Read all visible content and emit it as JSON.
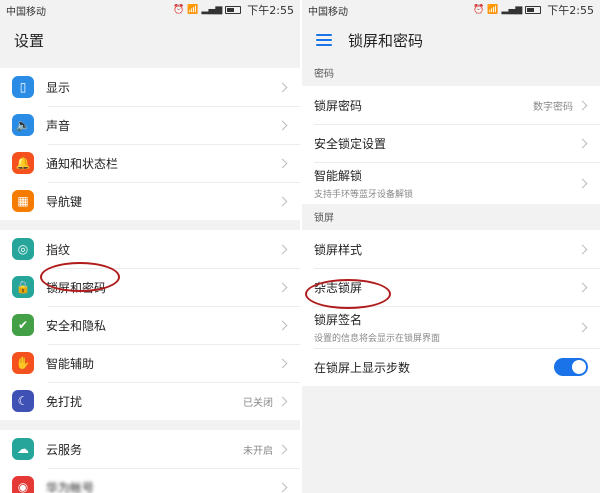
{
  "left": {
    "status": {
      "carrier": "中国移动",
      "time": "下午2:55"
    },
    "title": "设置",
    "groups": [
      [
        {
          "label": "显示",
          "icon": "display-icon",
          "color": "#2b8ce6"
        },
        {
          "label": "声音",
          "icon": "speaker-icon",
          "color": "#2b8ce6"
        },
        {
          "label": "通知和状态栏",
          "icon": "bell-icon",
          "color": "#f4511e"
        },
        {
          "label": "导航键",
          "icon": "navigation-key-icon",
          "color": "#f57c00"
        }
      ],
      [
        {
          "label": "指纹",
          "icon": "fingerprint-icon",
          "color": "#26a69a"
        },
        {
          "label": "锁屏和密码",
          "icon": "lock-icon",
          "color": "#26a69a"
        },
        {
          "label": "安全和隐私",
          "icon": "shield-icon",
          "color": "#43a047"
        },
        {
          "label": "智能辅助",
          "icon": "hand-icon",
          "color": "#f4511e"
        },
        {
          "label": "免打扰",
          "icon": "moon-icon",
          "color": "#3f51b5",
          "value": "已关闭"
        }
      ],
      [
        {
          "label": "云服务",
          "icon": "cloud-icon",
          "color": "#26a69a",
          "value": "未开启"
        },
        {
          "label": "华为帐号",
          "icon": "account-icon",
          "color": "#e53935",
          "blurred": true
        }
      ]
    ]
  },
  "right": {
    "status": {
      "carrier": "中国移动",
      "time": "下午2:55"
    },
    "title": "锁屏和密码",
    "section_password": "密码",
    "lock_password": {
      "label": "锁屏密码",
      "value": "数字密码"
    },
    "secure_lock": {
      "label": "安全锁定设置"
    },
    "smart_unlock": {
      "label": "智能解锁",
      "sub": "支持手环等蓝牙设备解锁"
    },
    "section_lockscreen": "锁屏",
    "lock_style": {
      "label": "锁屏样式"
    },
    "magazine_lock": {
      "label": "杂志锁屏"
    },
    "lock_signature": {
      "label": "锁屏签名",
      "sub": "设置的信息将会显示在锁屏界面"
    },
    "show_steps": {
      "label": "在锁屏上显示步数",
      "enabled": true
    }
  },
  "colors": {
    "accent": "#1a73e8",
    "annotation": "#b01c1c"
  }
}
